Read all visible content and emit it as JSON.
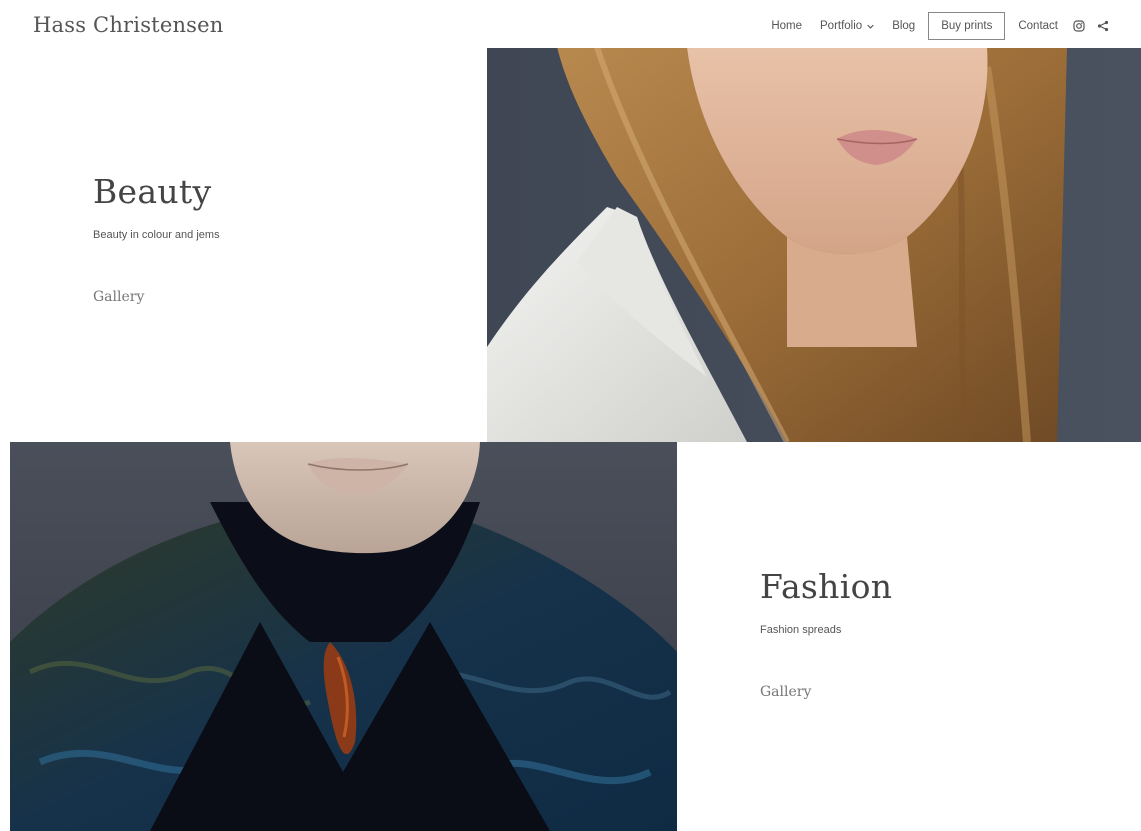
{
  "header": {
    "site_title": "Hass Christensen",
    "nav": {
      "home": "Home",
      "portfolio": "Portfolio",
      "blog": "Blog",
      "buy_prints": "Buy prints",
      "contact": "Contact"
    },
    "icons": [
      "instagram-icon",
      "share-icon"
    ]
  },
  "sections": {
    "beauty": {
      "title": "Beauty",
      "subtitle": "Beauty in colour and jems",
      "link": "Gallery"
    },
    "fashion": {
      "title": "Fashion",
      "subtitle": "Fashion spreads",
      "link": "Gallery"
    }
  },
  "colors": {
    "background": "#ffffff",
    "text": "#444444",
    "photo_backdrop": "#3b4250"
  }
}
